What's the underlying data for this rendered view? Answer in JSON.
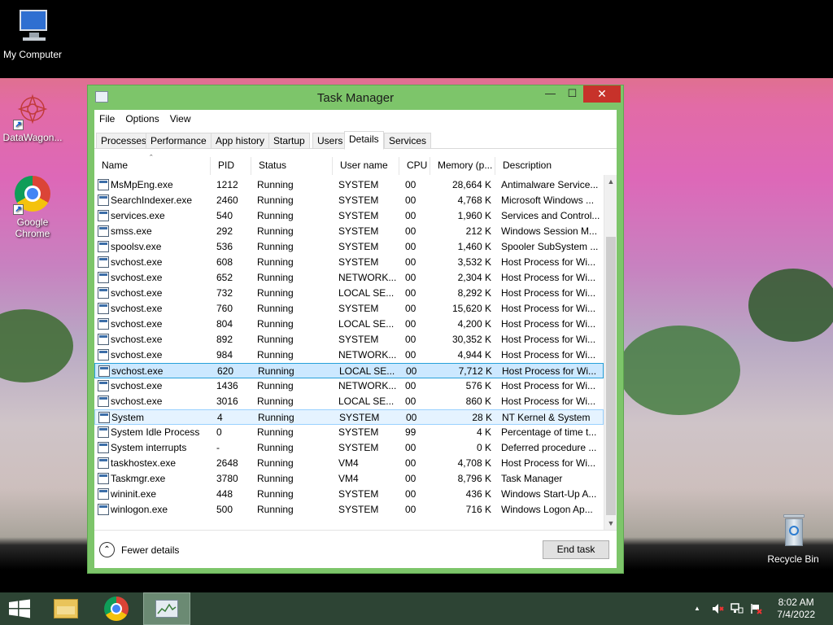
{
  "desktop": {
    "icons": [
      {
        "label": "My Computer",
        "icon": "computer-icon"
      },
      {
        "label": "DataWagon...",
        "icon": "datawagon-icon"
      },
      {
        "label": "Google Chrome",
        "icon": "chrome-icon"
      },
      {
        "label": "Recycle Bin",
        "icon": "recycle-bin-icon"
      }
    ],
    "shortcut_arrow": "↗"
  },
  "window": {
    "title": "Task Manager",
    "controls": {
      "minimize": "—",
      "maximize": "☐",
      "close": "✕"
    },
    "menu": [
      "File",
      "Options",
      "View"
    ],
    "tabs": [
      "Processes",
      "Performance",
      "App history",
      "Startup",
      "Users",
      "Details",
      "Services"
    ],
    "active_tab": "Details",
    "sort_indicator": "ˆ",
    "columns": [
      "Name",
      "PID",
      "Status",
      "User name",
      "CPU",
      "Memory (p...",
      "Description"
    ],
    "rows": [
      [
        "MsMpEng.exe",
        "1212",
        "Running",
        "SYSTEM",
        "00",
        "28,664 K",
        "Antimalware Service..."
      ],
      [
        "SearchIndexer.exe",
        "2460",
        "Running",
        "SYSTEM",
        "00",
        "4,768 K",
        "Microsoft Windows ..."
      ],
      [
        "services.exe",
        "540",
        "Running",
        "SYSTEM",
        "00",
        "1,960 K",
        "Services and Control..."
      ],
      [
        "smss.exe",
        "292",
        "Running",
        "SYSTEM",
        "00",
        "212 K",
        "Windows Session M..."
      ],
      [
        "spoolsv.exe",
        "536",
        "Running",
        "SYSTEM",
        "00",
        "1,460 K",
        "Spooler SubSystem ..."
      ],
      [
        "svchost.exe",
        "608",
        "Running",
        "SYSTEM",
        "00",
        "3,532 K",
        "Host Process for Wi..."
      ],
      [
        "svchost.exe",
        "652",
        "Running",
        "NETWORK...",
        "00",
        "2,304 K",
        "Host Process for Wi..."
      ],
      [
        "svchost.exe",
        "732",
        "Running",
        "LOCAL SE...",
        "00",
        "8,292 K",
        "Host Process for Wi..."
      ],
      [
        "svchost.exe",
        "760",
        "Running",
        "SYSTEM",
        "00",
        "15,620 K",
        "Host Process for Wi..."
      ],
      [
        "svchost.exe",
        "804",
        "Running",
        "LOCAL SE...",
        "00",
        "4,200 K",
        "Host Process for Wi..."
      ],
      [
        "svchost.exe",
        "892",
        "Running",
        "SYSTEM",
        "00",
        "30,352 K",
        "Host Process for Wi..."
      ],
      [
        "svchost.exe",
        "984",
        "Running",
        "NETWORK...",
        "00",
        "4,944 K",
        "Host Process for Wi..."
      ],
      [
        "svchost.exe",
        "620",
        "Running",
        "LOCAL SE...",
        "00",
        "7,712 K",
        "Host Process for Wi..."
      ],
      [
        "svchost.exe",
        "1436",
        "Running",
        "NETWORK...",
        "00",
        "576 K",
        "Host Process for Wi..."
      ],
      [
        "svchost.exe",
        "3016",
        "Running",
        "LOCAL SE...",
        "00",
        "860 K",
        "Host Process for Wi..."
      ],
      [
        "System",
        "4",
        "Running",
        "SYSTEM",
        "00",
        "28 K",
        "NT Kernel & System"
      ],
      [
        "System Idle Process",
        "0",
        "Running",
        "SYSTEM",
        "99",
        "4 K",
        "Percentage of time t..."
      ],
      [
        "System interrupts",
        "-",
        "Running",
        "SYSTEM",
        "00",
        "0 K",
        "Deferred procedure ..."
      ],
      [
        "taskhostex.exe",
        "2648",
        "Running",
        "VM4",
        "00",
        "4,708 K",
        "Host Process for Wi..."
      ],
      [
        "Taskmgr.exe",
        "3780",
        "Running",
        "VM4",
        "00",
        "8,796 K",
        "Task Manager"
      ],
      [
        "wininit.exe",
        "448",
        "Running",
        "SYSTEM",
        "00",
        "436 K",
        "Windows Start-Up A..."
      ],
      [
        "winlogon.exe",
        "500",
        "Running",
        "SYSTEM",
        "00",
        "716 K",
        "Windows Logon Ap..."
      ]
    ],
    "selected_row": 12,
    "hover_row": 15,
    "scrollbar": {
      "up": "▲",
      "down": "▼"
    },
    "footer": {
      "fewer_details": "Fewer details",
      "fewer_icon": "⌃",
      "end_task": "End task"
    }
  },
  "taskbar": {
    "clock_time": "8:02 AM",
    "clock_date": "7/4/2022",
    "tray_chevron": "▲"
  },
  "colors": {
    "window_frame": "#7dc56a",
    "close_button": "#c7322a",
    "selection": "#cce8ff",
    "taskbar": "#2d4434"
  }
}
